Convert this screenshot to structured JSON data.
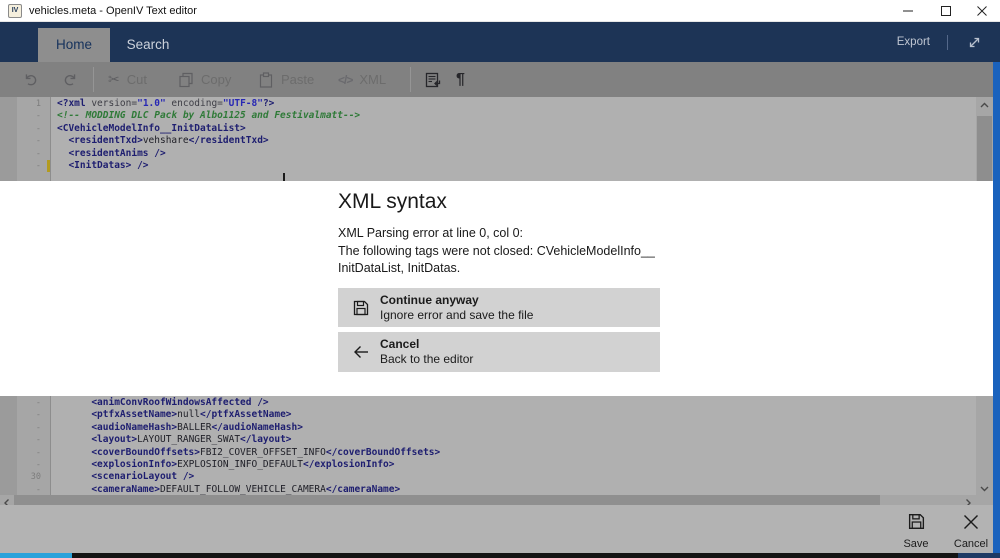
{
  "window": {
    "title": "vehicles.meta - OpenIV Text editor",
    "icon_text": "IV"
  },
  "ribbon": {
    "home_tab": "Home",
    "search_tab": "Search",
    "export_label": "Export"
  },
  "toolbar": {
    "cut_label": "Cut",
    "copy_label": "Copy",
    "paste_label": "Paste",
    "xml_label": "XML",
    "xml_glyph": "</>",
    "scissors_glyph": "✂",
    "pilcrow_glyph": "¶"
  },
  "editor": {
    "top_lines": [
      {
        "n": "1",
        "t": [
          [
            "tag",
            "<?xml"
          ],
          [
            "attr",
            " version="
          ],
          [
            "val",
            "\"1.0\""
          ],
          [
            "attr",
            " encoding="
          ],
          [
            "val",
            "\"UTF-8\""
          ],
          [
            "tag",
            "?>"
          ]
        ]
      },
      {
        "n": "-",
        "t": [
          [
            "comment",
            "<!-- MODDING DLC Pack by Albo1125 and Festivalmatt-->"
          ]
        ]
      },
      {
        "n": "-",
        "t": [
          [
            "tag",
            "<CVehicleModelInfo__InitDataList>"
          ]
        ]
      },
      {
        "n": "-",
        "t": [
          [
            "text",
            "  "
          ],
          [
            "tag",
            "<residentTxd>"
          ],
          [
            "text",
            "vehshare"
          ],
          [
            "tag",
            "</residentTxd>"
          ]
        ]
      },
      {
        "n": "-",
        "t": [
          [
            "text",
            "  "
          ],
          [
            "tag",
            "<residentAnims />"
          ]
        ]
      },
      {
        "n": "-",
        "m": true,
        "t": [
          [
            "text",
            "  "
          ],
          [
            "tag",
            "<InitDatas> />"
          ]
        ]
      },
      {
        "n": "",
        "t": []
      }
    ],
    "bottom_lines": [
      {
        "n": "-",
        "t": [
          [
            "text",
            "      "
          ],
          [
            "tag",
            "<animConvRoofWindowsAffected />"
          ]
        ]
      },
      {
        "n": "-",
        "t": [
          [
            "text",
            "      "
          ],
          [
            "tag",
            "<ptfxAssetName>"
          ],
          [
            "text",
            "null"
          ],
          [
            "tag",
            "</ptfxAssetName>"
          ]
        ]
      },
      {
        "n": "-",
        "t": [
          [
            "text",
            "      "
          ],
          [
            "tag",
            "<audioNameHash>"
          ],
          [
            "text",
            "BALLER"
          ],
          [
            "tag",
            "</audioNameHash>"
          ]
        ]
      },
      {
        "n": "-",
        "t": [
          [
            "text",
            "      "
          ],
          [
            "tag",
            "<layout>"
          ],
          [
            "text",
            "LAYOUT_RANGER_SWAT"
          ],
          [
            "tag",
            "</layout>"
          ]
        ]
      },
      {
        "n": "-",
        "t": [
          [
            "text",
            "      "
          ],
          [
            "tag",
            "<coverBoundOffsets>"
          ],
          [
            "text",
            "FBI2_COVER_OFFSET_INFO"
          ],
          [
            "tag",
            "</coverBoundOffsets>"
          ]
        ]
      },
      {
        "n": "-",
        "t": [
          [
            "text",
            "      "
          ],
          [
            "tag",
            "<explosionInfo>"
          ],
          [
            "text",
            "EXPLOSION_INFO_DEFAULT"
          ],
          [
            "tag",
            "</explosionInfo>"
          ]
        ]
      },
      {
        "n": "30",
        "t": [
          [
            "text",
            "      "
          ],
          [
            "tag",
            "<scenarioLayout />"
          ]
        ]
      },
      {
        "n": "-",
        "t": [
          [
            "text",
            "      "
          ],
          [
            "tag",
            "<cameraName>"
          ],
          [
            "text",
            "DEFAULT_FOLLOW_VEHICLE_CAMERA"
          ],
          [
            "tag",
            "</cameraName>"
          ]
        ]
      }
    ]
  },
  "dialog": {
    "title": "XML syntax",
    "message_lines": [
      "XML Parsing error at line 0, col 0:",
      "The following tags were not closed: CVehicleModelInfo__",
      "InitDataList, InitDatas."
    ],
    "buttons": [
      {
        "title": "Continue anyway",
        "subtitle": "Ignore error and save the file"
      },
      {
        "title": "Cancel",
        "subtitle": "Back to the editor"
      }
    ]
  },
  "footer": {
    "save_label": "Save",
    "cancel_label": "Cancel"
  },
  "colors": {
    "ribbon_navy": "#1d3456",
    "accent_border": "#1a62bd",
    "dialog_button_bg": "#d2d2d2",
    "taskbar_highlight": "#2aa2da",
    "editor_dim_bg": "#b0b0b0"
  }
}
